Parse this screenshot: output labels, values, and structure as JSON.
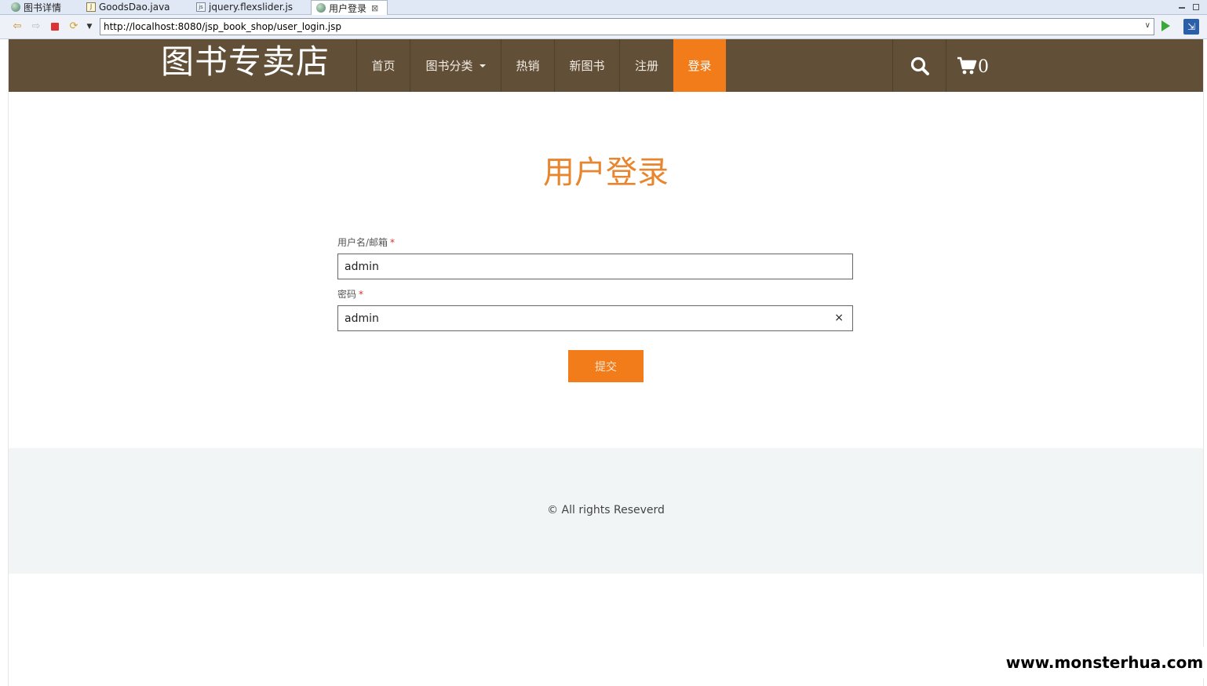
{
  "editor_tabs": [
    {
      "label": "图书详情",
      "icon": "globe-icon"
    },
    {
      "label": "GoodsDao.java",
      "icon": "java-file-icon"
    },
    {
      "label": "jquery.flexslider.js",
      "icon": "js-file-icon"
    },
    {
      "label": "用户登录",
      "icon": "globe-icon",
      "active": true,
      "close": "⊠"
    }
  ],
  "browser": {
    "url": "http://localhost:8080/jsp_book_shop/user_login.jsp"
  },
  "site": {
    "brand": "图书专卖店",
    "nav": [
      {
        "label": "首页"
      },
      {
        "label": "图书分类",
        "has_dropdown": true
      },
      {
        "label": "热销"
      },
      {
        "label": "新图书"
      },
      {
        "label": "注册"
      },
      {
        "label": "登录",
        "active": true
      }
    ],
    "cart_count": "0",
    "icons": {
      "search": "search-icon",
      "cart": "cart-icon"
    },
    "colors": {
      "navbar": "#624f37",
      "accent": "#f27b1a",
      "title": "#e8862f"
    }
  },
  "login": {
    "title": "用户登录",
    "username": {
      "label": "用户名/邮箱",
      "required_mark": "*",
      "value": "admin"
    },
    "password": {
      "label": "密码",
      "required_mark": "*",
      "value": "admin",
      "clear": "×"
    },
    "submit_label": "提交"
  },
  "footer": {
    "copyright": "© All rights Reseverd"
  },
  "watermark": "www.monsterhua.com"
}
